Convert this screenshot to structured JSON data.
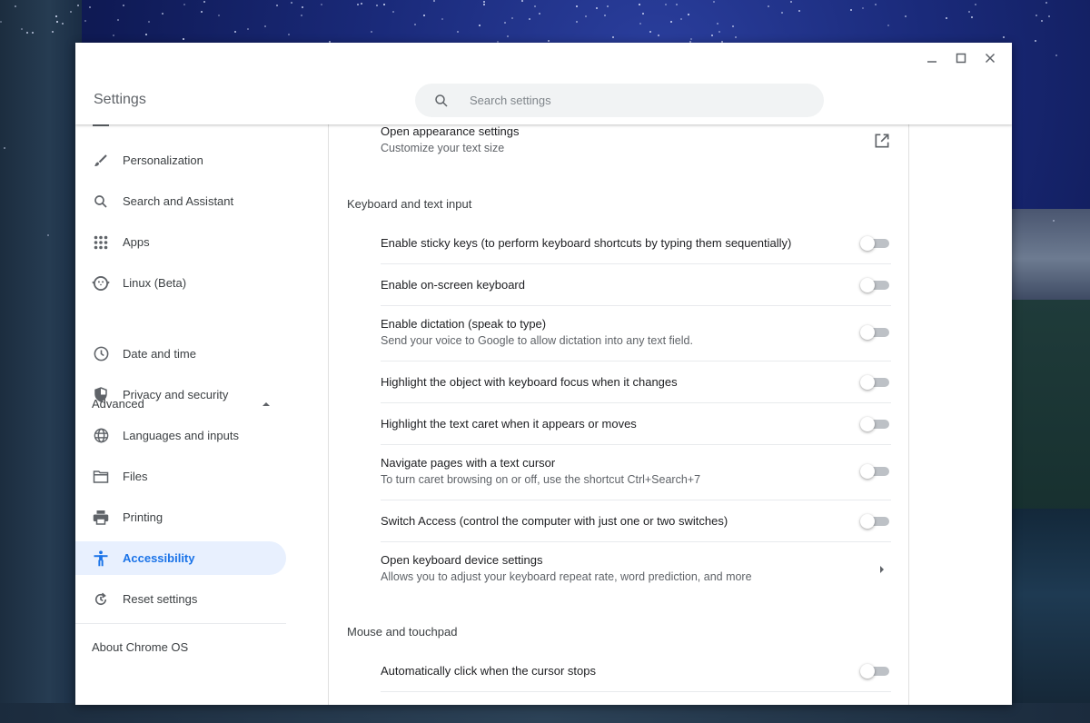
{
  "window": {
    "title": "Settings",
    "controls": {
      "minimize": "minimize-icon",
      "maximize": "maximize-icon",
      "close": "close-icon"
    }
  },
  "search": {
    "placeholder": "Search settings",
    "value": "",
    "icon": "search-icon"
  },
  "sidebar": {
    "items": [
      {
        "label": "Personalization",
        "icon": "brush-icon"
      },
      {
        "label": "Search and Assistant",
        "icon": "search-icon"
      },
      {
        "label": "Apps",
        "icon": "apps-grid-icon"
      },
      {
        "label": "Linux (Beta)",
        "icon": "penguin-icon"
      }
    ],
    "advanced": {
      "label": "Advanced",
      "expanded": true
    },
    "advanced_items": [
      {
        "label": "Date and time",
        "icon": "clock-icon"
      },
      {
        "label": "Privacy and security",
        "icon": "shield-icon"
      },
      {
        "label": "Languages and inputs",
        "icon": "globe-icon"
      },
      {
        "label": "Files",
        "icon": "folder-icon"
      },
      {
        "label": "Printing",
        "icon": "printer-icon"
      },
      {
        "label": "Accessibility",
        "icon": "accessibility-icon",
        "active": true
      },
      {
        "label": "Reset settings",
        "icon": "reset-icon"
      }
    ],
    "about": "About Chrome OS"
  },
  "main": {
    "appearance": {
      "title": "Open appearance settings",
      "subtitle": "Customize your text size",
      "icon": "open-in-new-icon"
    },
    "keyboard_section": {
      "title": "Keyboard and text input",
      "rows": [
        {
          "title": "Enable sticky keys (to perform keyboard shortcuts by typing them sequentially)",
          "enabled": false
        },
        {
          "title": "Enable on-screen keyboard",
          "enabled": false
        },
        {
          "title": "Enable dictation (speak to type)",
          "subtitle": "Send your voice to Google to allow dictation into any text field.",
          "enabled": false
        },
        {
          "title": "Highlight the object with keyboard focus when it changes",
          "enabled": false
        },
        {
          "title": "Highlight the text caret when it appears or moves",
          "enabled": false
        },
        {
          "title": "Navigate pages with a text cursor",
          "subtitle": "To turn caret browsing on or off, use the shortcut Ctrl+Search+7",
          "enabled": false
        },
        {
          "title": "Switch Access (control the computer with just one or two switches)",
          "enabled": false
        }
      ],
      "device_link": {
        "title": "Open keyboard device settings",
        "subtitle": "Allows you to adjust your keyboard repeat rate, word prediction, and more",
        "icon": "arrow-right-icon"
      }
    },
    "mouse_section": {
      "title": "Mouse and touchpad",
      "rows": [
        {
          "title": "Automatically click when the cursor stops",
          "enabled": false
        }
      ]
    }
  },
  "colors": {
    "accent": "#1a73e8",
    "active_bg": "#e8f0fe",
    "toggle_off_track": "#bdc1c6"
  }
}
